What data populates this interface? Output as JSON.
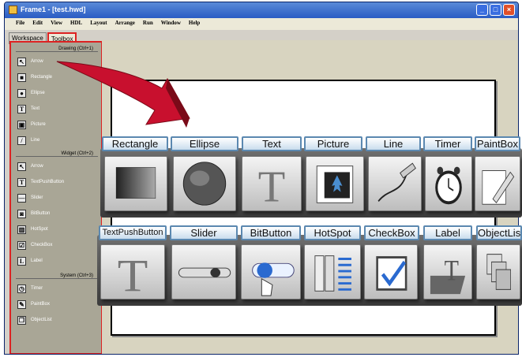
{
  "window": {
    "title": "Frame1 - [test.hwd]"
  },
  "menu": [
    "File",
    "Edit",
    "View",
    "HDL",
    "Layout",
    "Arrange",
    "Run",
    "Window",
    "Help"
  ],
  "tabs": [
    "Workspace",
    "Toolbox"
  ],
  "toolbox": {
    "groups": [
      {
        "title": "Drawing (Ctrl+1)",
        "items": [
          {
            "label": "Arrow",
            "icon": "arrow-icon"
          },
          {
            "label": "Rectangle",
            "icon": "rectangle-icon"
          },
          {
            "label": "Ellipse",
            "icon": "ellipse-icon"
          },
          {
            "label": "Text",
            "icon": "text-icon"
          },
          {
            "label": "Picture",
            "icon": "picture-icon"
          },
          {
            "label": "Line",
            "icon": "line-icon"
          }
        ]
      },
      {
        "title": "Widget (Ctrl+2)",
        "items": [
          {
            "label": "Arrow",
            "icon": "arrow-icon"
          },
          {
            "label": "TextPushButton",
            "icon": "text-push-button-icon"
          },
          {
            "label": "Slider",
            "icon": "slider-icon"
          },
          {
            "label": "BitButton",
            "icon": "bit-button-icon"
          },
          {
            "label": "HotSpot",
            "icon": "hotspot-icon"
          },
          {
            "label": "CheckBox",
            "icon": "checkbox-icon"
          },
          {
            "label": "Label",
            "icon": "label-icon"
          }
        ]
      },
      {
        "title": "System (Ctrl+3)",
        "items": [
          {
            "label": "Timer",
            "icon": "timer-icon"
          },
          {
            "label": "PaintBox",
            "icon": "paintbox-icon"
          },
          {
            "label": "ObjectList",
            "icon": "object-list-icon"
          }
        ]
      }
    ]
  },
  "callout": {
    "row1": [
      "Rectangle",
      "Ellipse",
      "Text",
      "Picture",
      "Line",
      "Timer",
      "PaintBox"
    ],
    "row2": [
      "TextPushButton",
      "Slider",
      "BitButton",
      "HotSpot",
      "CheckBox",
      "Label",
      "ObjectList"
    ]
  },
  "colors": {
    "highlight": "#dd2222",
    "header_border": "#5b88b0",
    "arrow": "#c8102e"
  }
}
